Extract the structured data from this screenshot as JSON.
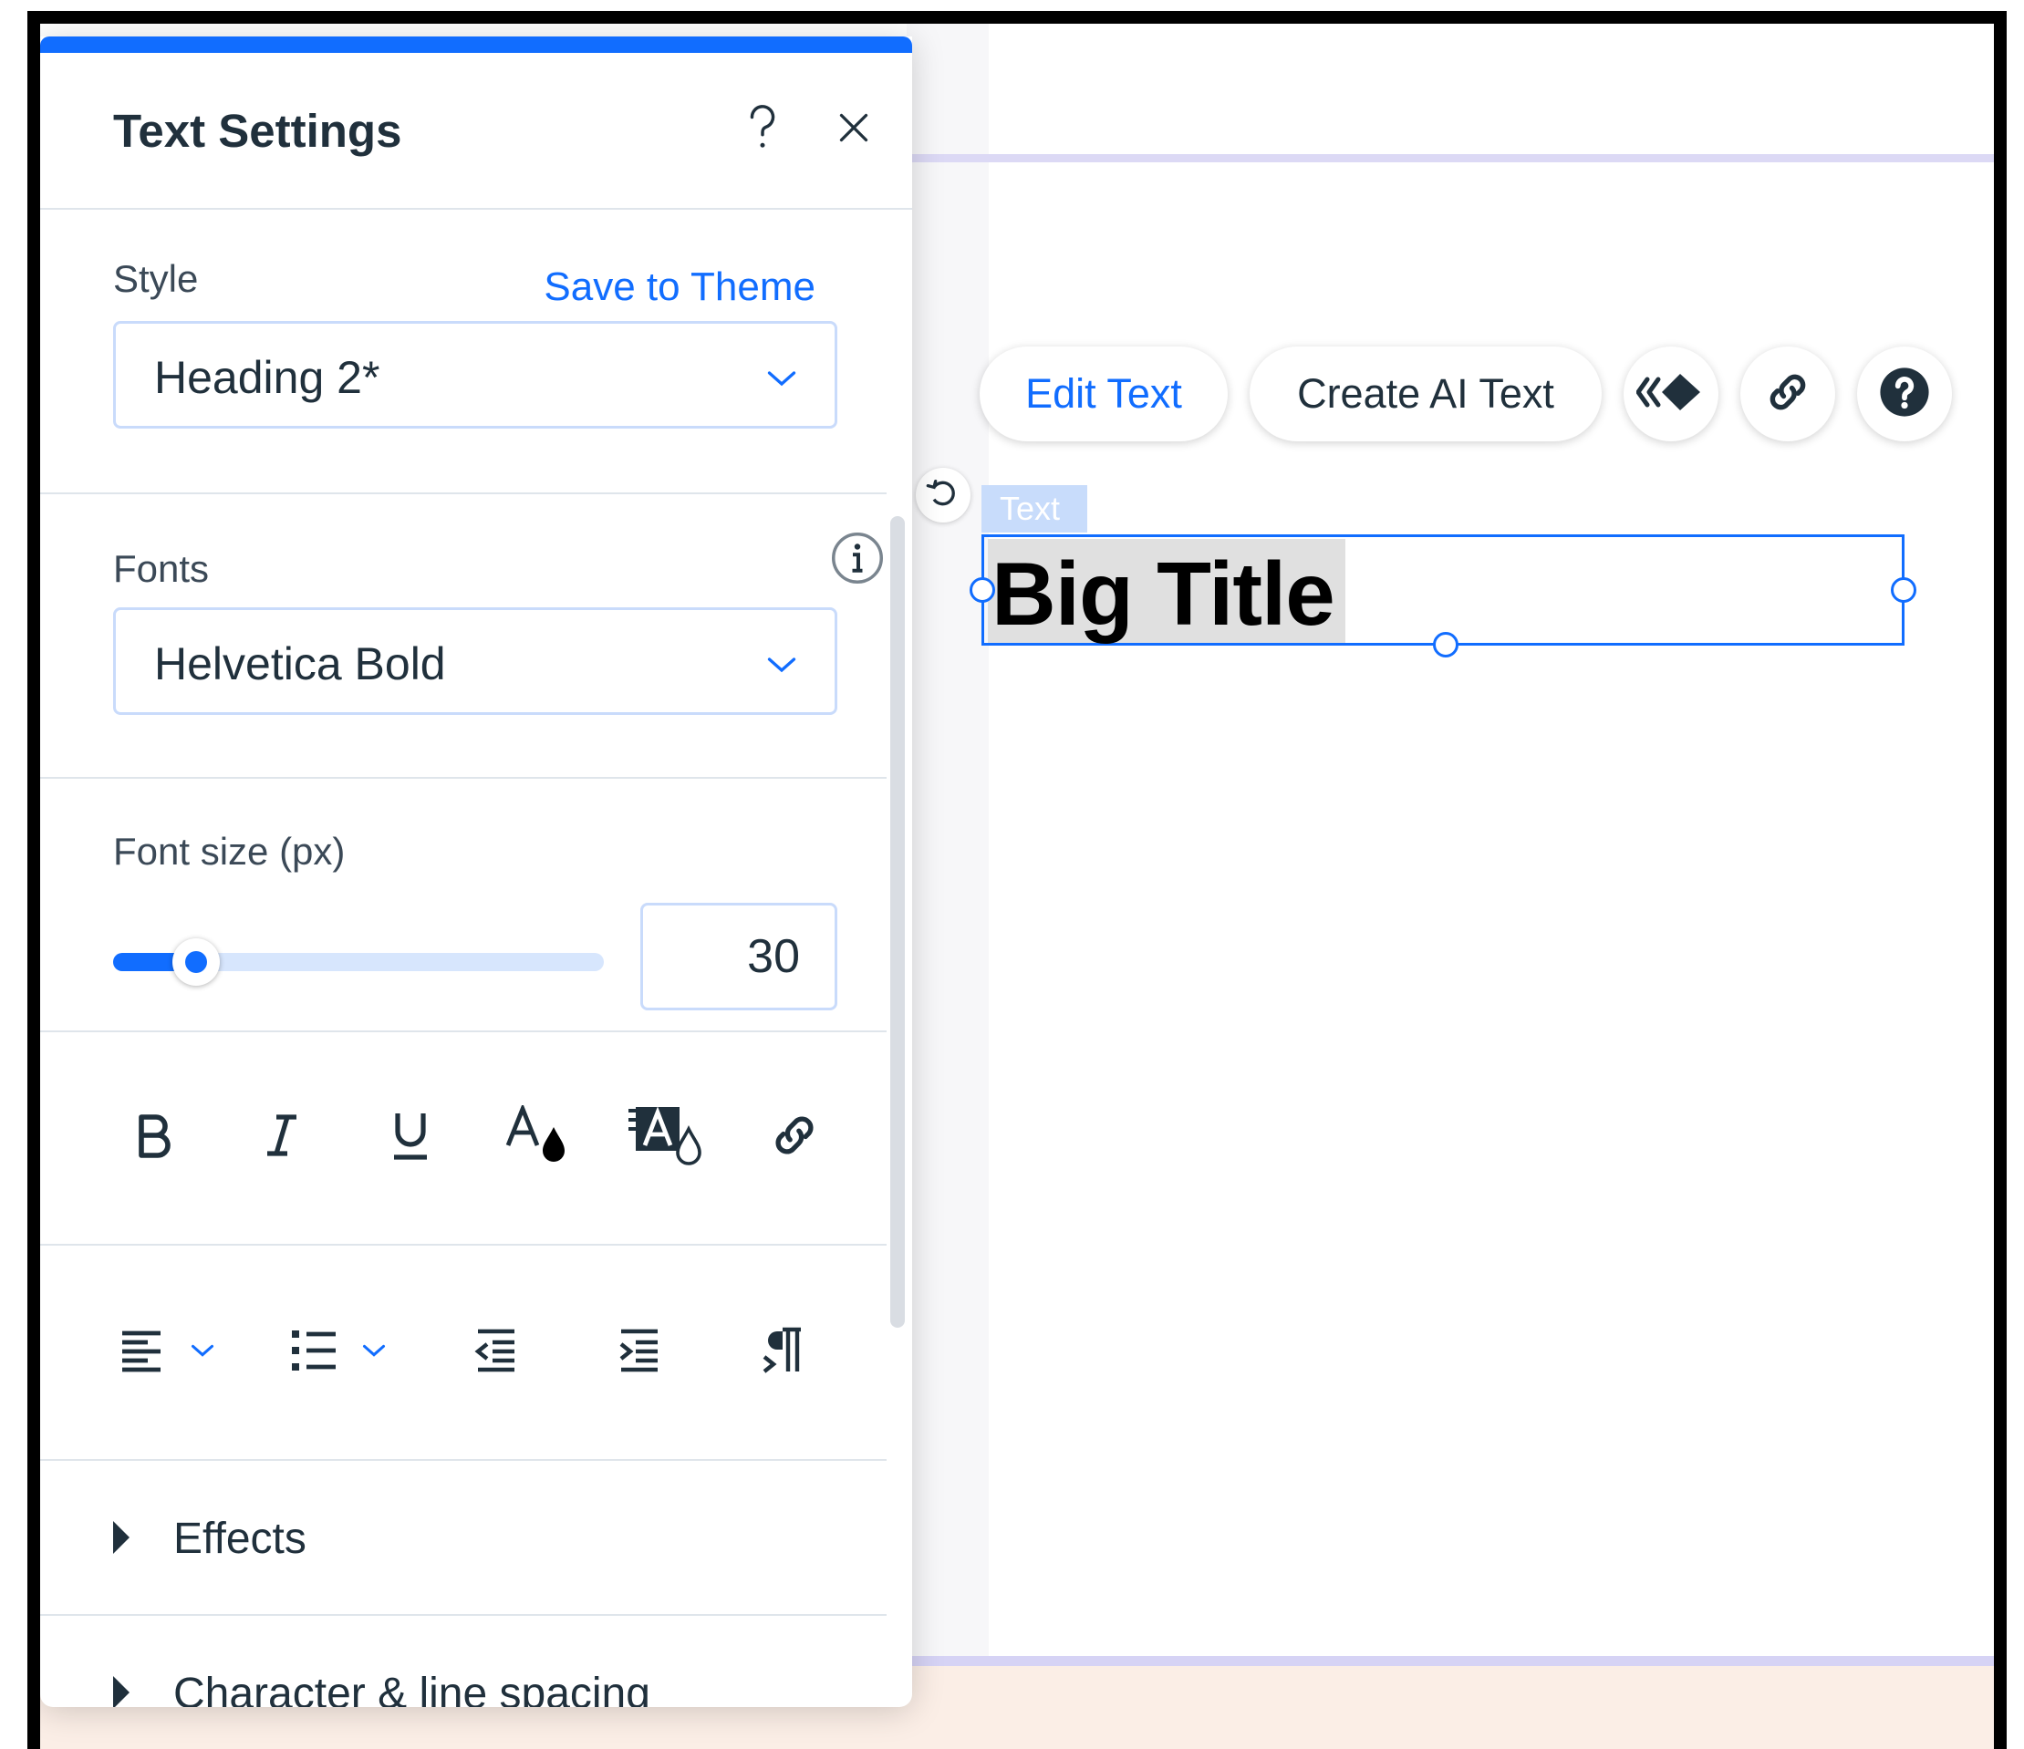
{
  "panel": {
    "title": "Text Settings",
    "help_icon": "question-mark-icon",
    "close_icon": "close-icon",
    "style": {
      "label": "Style",
      "save_link": "Save to Theme",
      "value": "Heading 2*"
    },
    "fonts": {
      "label": "Fonts",
      "info_icon": "info-icon",
      "value": "Helvetica Bold"
    },
    "font_size": {
      "label": "Font size (px)",
      "value": "30",
      "slider_fraction": 0.17
    },
    "format_tools": [
      "bold-icon",
      "italic-icon",
      "underline-icon",
      "text-color-icon",
      "highlight-color-icon",
      "link-icon"
    ],
    "paragraph_tools": [
      "align-left-icon",
      "bullet-list-icon",
      "decrease-indent-icon",
      "increase-indent-icon",
      "text-direction-icon"
    ],
    "collapsible": [
      {
        "label": "Effects"
      },
      {
        "label": "Character & line spacing"
      }
    ]
  },
  "toolbar": {
    "edit_text": "Edit Text",
    "create_ai_text": "Create AI Text",
    "animation_icon": "animation-icon",
    "link_icon": "link-icon",
    "help_icon": "help-circle-icon"
  },
  "canvas": {
    "element_tag": "Text",
    "title_text": "Big Title"
  },
  "colors": {
    "accent": "#116dff",
    "text": "#20303c",
    "footer": "#fbeee6"
  }
}
